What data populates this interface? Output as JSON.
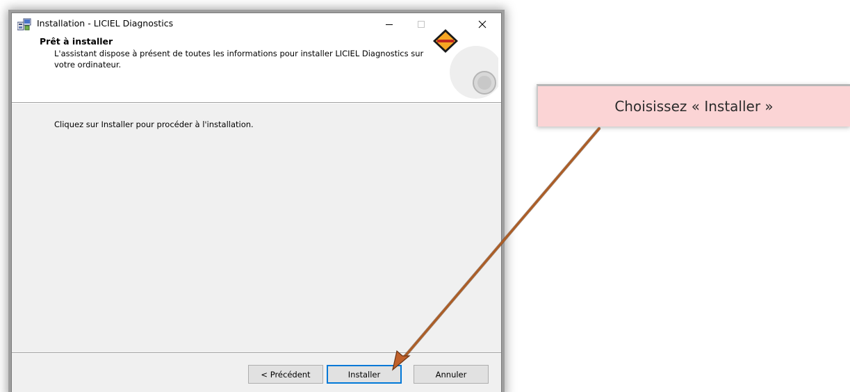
{
  "window": {
    "title": "Installation - LICIEL Diagnostics",
    "minimize_glyph": "—",
    "maximize_glyph": "☐",
    "close_glyph": "✕"
  },
  "header": {
    "title": "Prêt à installer",
    "description": "L'assistant dispose à présent de toutes les informations pour installer LICIEL Diagnostics sur votre ordinateur."
  },
  "body": {
    "instruction": "Cliquez sur Installer pour procéder à l'installation."
  },
  "buttons": {
    "previous": "< Précédent",
    "install": "Installer",
    "cancel": "Annuler"
  },
  "callout": {
    "text": "Choisissez « Installer »"
  },
  "icons": {
    "app_icon": "installer-icon",
    "logo": "liciel-logo-icon",
    "arrow": "arrow-icon"
  },
  "colors": {
    "callout_bg": "#fbd4d5",
    "arrow": "#c0602a",
    "focus_border": "#0078d7"
  }
}
